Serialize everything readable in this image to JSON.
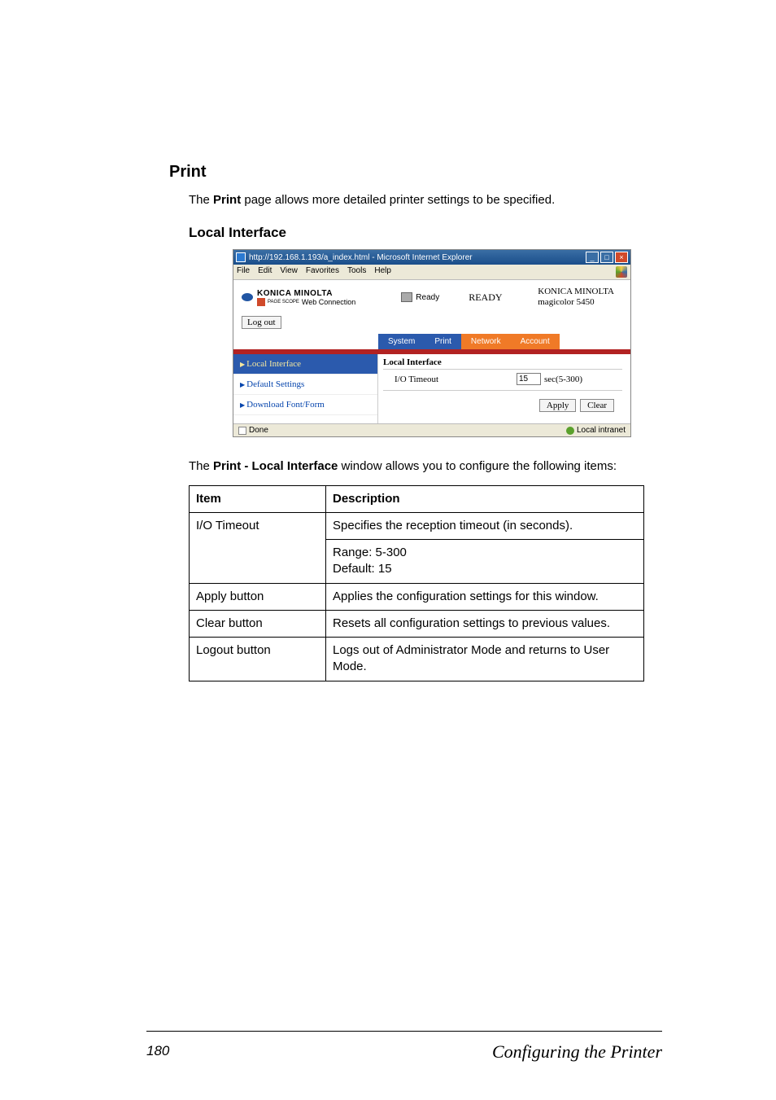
{
  "headings": {
    "print": "Print",
    "local_interface": "Local Interface"
  },
  "intro": {
    "pre": "The ",
    "bold": "Print",
    "post": " page allows more detailed printer settings to be specified."
  },
  "shot": {
    "titlebar": "http://192.168.1.193/a_index.html - Microsoft Internet Explorer",
    "menu": {
      "file": "File",
      "edit": "Edit",
      "view": "View",
      "fav": "Favorites",
      "tools": "Tools",
      "help": "Help"
    },
    "brand": "KONICA MINOLTA",
    "subbrand": "Web Connection",
    "subbrand_prefix": "PAGE SCOPE",
    "ready_label": "Ready",
    "status_big": "READY",
    "model_line1": "KONICA MINOLTA",
    "model_line2": "magicolor 5450",
    "logout": "Log out",
    "tabs": {
      "system": "System",
      "print": "Print",
      "network": "Network",
      "account": "Account"
    },
    "side": {
      "li": "Local Interface",
      "ds": "Default Settings",
      "df": "Download Font/Form"
    },
    "pane_title": "Local Interface",
    "io_label": "I/O Timeout",
    "io_value": "15",
    "io_range": "sec(5-300)",
    "apply": "Apply",
    "clear": "Clear",
    "status_done": "Done",
    "status_zone": "Local intranet"
  },
  "desc": {
    "pre": "The ",
    "bold": "Print - Local Interface",
    "post": " window allows you to configure the following items:"
  },
  "table": {
    "h_item": "Item",
    "h_desc": "Description",
    "rows": [
      {
        "item": "I/O Timeout",
        "desc": "Specifies the reception timeout (in seconds).",
        "extra1": "Range:  5-300",
        "extra2": "Default:  15"
      },
      {
        "item": "Apply button",
        "desc": "Applies the configuration settings for this window."
      },
      {
        "item": "Clear button",
        "desc": "Resets all configuration settings to previous values."
      },
      {
        "item": "Logout button",
        "desc": "Logs out of Administrator Mode and returns to User Mode."
      }
    ]
  },
  "footer": {
    "page": "180",
    "title": "Configuring the Printer"
  }
}
